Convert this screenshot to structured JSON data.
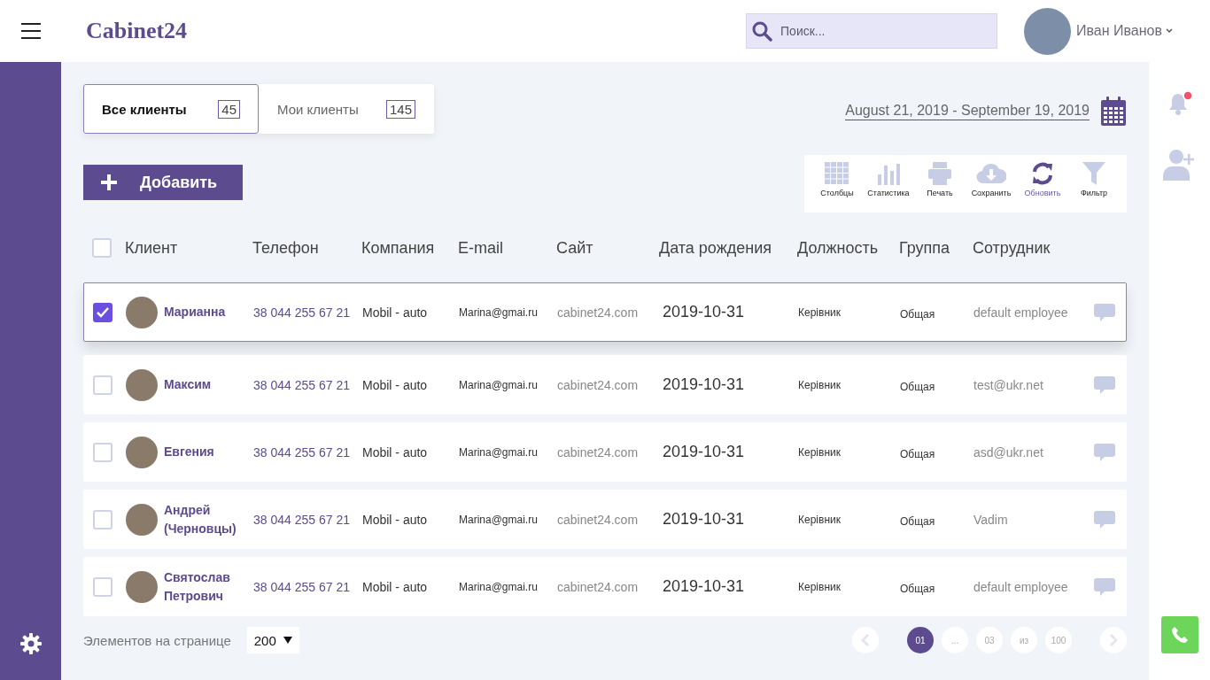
{
  "header": {
    "logo": "Cabinet24",
    "search": {
      "placeholder": "Поиск..."
    },
    "user": {
      "name": "Иван Иванов"
    }
  },
  "tabs": [
    {
      "label": "Все клиенты",
      "count": "45",
      "selected": true
    },
    {
      "label": "Мои клиенты",
      "count": "145",
      "selected": false
    }
  ],
  "date_range": "August 21, 2019 - September 19, 2019",
  "add_button": "Добавить",
  "toolbar": [
    {
      "kind": "columns",
      "label": "Столбцы",
      "active": false
    },
    {
      "kind": "stats",
      "label": "Статистика",
      "active": false
    },
    {
      "kind": "print",
      "label": "Печать",
      "active": false
    },
    {
      "kind": "save",
      "label": "Сохранить",
      "active": false
    },
    {
      "kind": "refresh",
      "label": "Обновить",
      "active": true
    },
    {
      "kind": "filter",
      "label": "Фильтр",
      "active": false
    }
  ],
  "table": {
    "select_all_checked": false,
    "columns": [
      "Клиент",
      "Телефон",
      "Компания",
      "E-mail",
      "Сайт",
      "Дата рождения",
      "Должность",
      "Группа",
      "Сотрудник"
    ],
    "rows": [
      {
        "checked": true,
        "name": "Марианна",
        "phone": "38 044 255 67 21",
        "company": "Mobil - auto",
        "email": "Marina@gmai.ru",
        "site": "cabinet24.com",
        "birth_date": "2019-10-31",
        "position": "Керівник",
        "group": "Общая",
        "employee": "default employee"
      },
      {
        "checked": false,
        "name": "Максим",
        "phone": "38 044 255 67 21",
        "company": "Mobil - auto",
        "email": "Marina@gmai.ru",
        "site": "cabinet24.com",
        "birth_date": "2019-10-31",
        "position": "Керівник",
        "group": "Общая",
        "employee": "test@ukr.net"
      },
      {
        "checked": false,
        "name": "Евгения",
        "phone": "38 044 255 67 21",
        "company": "Mobil - auto",
        "email": "Marina@gmai.ru",
        "site": "cabinet24.com",
        "birth_date": "2019-10-31",
        "position": "Керівник",
        "group": "Общая",
        "employee": "asd@ukr.net"
      },
      {
        "checked": false,
        "name": "Андрей (Черновцы)",
        "phone": "38 044 255 67 21",
        "company": "Mobil - auto",
        "email": "Marina@gmai.ru",
        "site": "cabinet24.com",
        "birth_date": "2019-10-31",
        "position": "Керівник",
        "group": "Общая",
        "employee": "Vadim"
      },
      {
        "checked": false,
        "name": "Святослав Петрович",
        "phone": "38 044 255 67 21",
        "company": "Mobil - auto",
        "email": "Marina@gmai.ru",
        "site": "cabinet24.com",
        "birth_date": "2019-10-31",
        "position": "Керівник",
        "group": "Общая",
        "employee": "default employee"
      }
    ]
  },
  "footer": {
    "page_size_label": "Элементов на странице",
    "page_size": "200",
    "pages": [
      {
        "label": "01",
        "selected": true
      },
      {
        "label": "...",
        "selected": false
      },
      {
        "label": "03",
        "selected": false
      },
      {
        "label": "из",
        "selected": false
      },
      {
        "label": "100",
        "selected": false
      }
    ]
  },
  "notifications": {
    "unread": true
  }
}
